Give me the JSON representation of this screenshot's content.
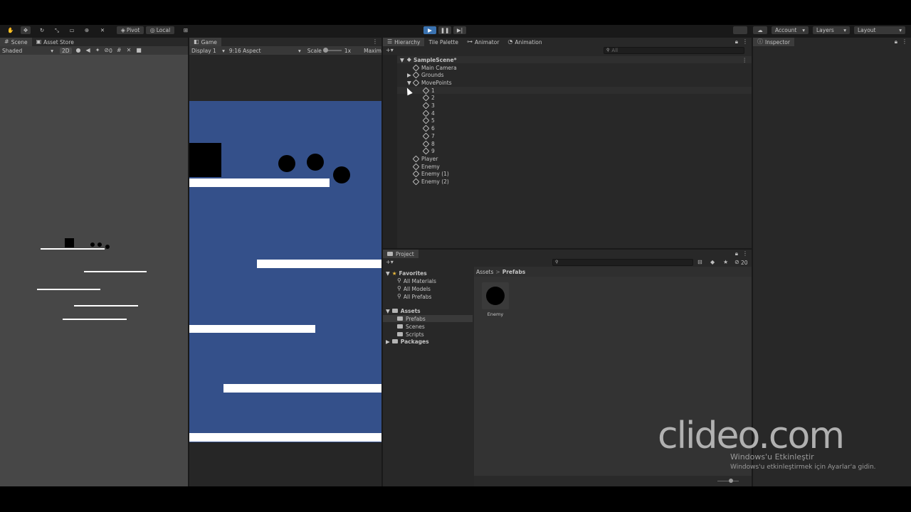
{
  "toolbar": {
    "pivot": "Pivot",
    "local": "Local",
    "account": "Account",
    "layers": "Layers",
    "layout": "Layout"
  },
  "scene": {
    "tab": "Scene",
    "asset_store_tab": "Asset Store",
    "shading": "Shaded",
    "mode_2d": "2D",
    "gizmo_count": "0"
  },
  "game": {
    "tab": "Game",
    "display": "Display 1",
    "aspect": "9:16 Aspect",
    "scale_label": "Scale",
    "scale_value": "1x",
    "maximize": "Maxim"
  },
  "hierarchy": {
    "tabs": [
      "Hierarchy",
      "Tile Palette",
      "Animator",
      "Animation"
    ],
    "search_placeholder": "All",
    "scene_name": "SampleScene*",
    "items": [
      {
        "label": "Main Camera",
        "depth": 1
      },
      {
        "label": "Grounds",
        "depth": 1,
        "expander": "▶"
      },
      {
        "label": "MovePoints",
        "depth": 1,
        "expander": "▼"
      },
      {
        "label": "1",
        "depth": 2
      },
      {
        "label": "2",
        "depth": 2
      },
      {
        "label": "3",
        "depth": 2
      },
      {
        "label": "4",
        "depth": 2
      },
      {
        "label": "5",
        "depth": 2
      },
      {
        "label": "6",
        "depth": 2
      },
      {
        "label": "7",
        "depth": 2
      },
      {
        "label": "8",
        "depth": 2
      },
      {
        "label": "9",
        "depth": 2
      },
      {
        "label": "Player",
        "depth": 1
      },
      {
        "label": "Enemy",
        "depth": 1
      },
      {
        "label": "Enemy (1)",
        "depth": 1
      },
      {
        "label": "Enemy (2)",
        "depth": 1
      }
    ]
  },
  "inspector": {
    "tab": "Inspector"
  },
  "project": {
    "tab": "Project",
    "hidden_count": "20",
    "favorites_label": "Favorites",
    "favorites": [
      "All Materials",
      "All Models",
      "All Prefabs"
    ],
    "assets_label": "Assets",
    "assets_children": [
      "Prefabs",
      "Scenes",
      "Scripts"
    ],
    "packages_label": "Packages",
    "breadcrumb_root": "Assets",
    "breadcrumb_sep": ">",
    "breadcrumb_current": "Prefabs",
    "prefab_name": "Enemy"
  },
  "overlay": {
    "watermark": "clideo.com",
    "activation_title": "Windows'u Etkinleştir",
    "activation_sub": "Windows'u etkinleştirmek için Ayarlar'a gidin."
  },
  "colors": {
    "game_background": "#34508a",
    "play_button": "#3a72b0",
    "selection": "#2c5d87"
  }
}
